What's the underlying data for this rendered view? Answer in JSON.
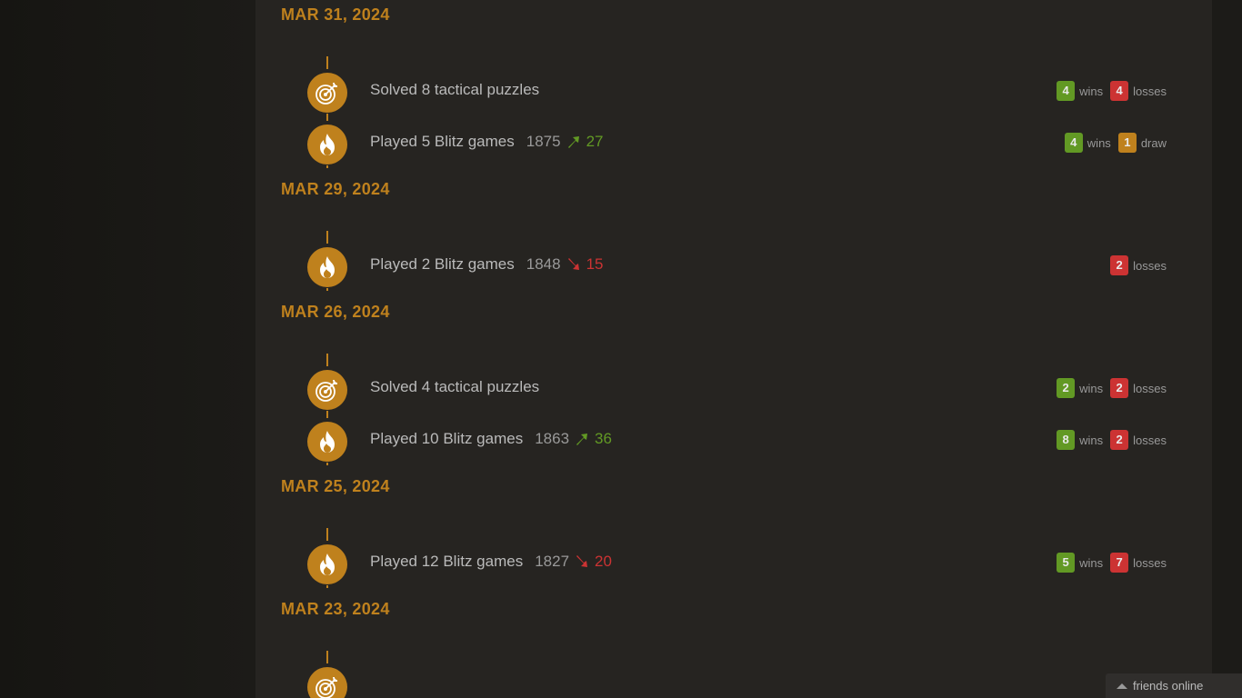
{
  "activity": [
    {
      "date": "MAR 31, 2024",
      "entries": [
        {
          "icon": "target-icon",
          "text": "Solved 8 tactical puzzles",
          "results": [
            {
              "n": "4",
              "label": "wins",
              "kind": "win"
            },
            {
              "n": "4",
              "label": "losses",
              "kind": "loss"
            }
          ]
        },
        {
          "icon": "flame-icon",
          "text": "Played 5 Blitz games",
          "rating": "1875",
          "delta": "27",
          "dir": "up",
          "results": [
            {
              "n": "4",
              "label": "wins",
              "kind": "win"
            },
            {
              "n": "1",
              "label": "draw",
              "kind": "draw"
            }
          ]
        }
      ]
    },
    {
      "date": "MAR 29, 2024",
      "entries": [
        {
          "icon": "flame-icon",
          "text": "Played 2 Blitz games",
          "rating": "1848",
          "delta": "15",
          "dir": "down",
          "results": [
            {
              "n": "2",
              "label": "losses",
              "kind": "loss"
            }
          ]
        }
      ]
    },
    {
      "date": "MAR 26, 2024",
      "entries": [
        {
          "icon": "target-icon",
          "text": "Solved 4 tactical puzzles",
          "results": [
            {
              "n": "2",
              "label": "wins",
              "kind": "win"
            },
            {
              "n": "2",
              "label": "losses",
              "kind": "loss"
            }
          ]
        },
        {
          "icon": "flame-icon",
          "text": "Played 10 Blitz games",
          "rating": "1863",
          "delta": "36",
          "dir": "up",
          "results": [
            {
              "n": "8",
              "label": "wins",
              "kind": "win"
            },
            {
              "n": "2",
              "label": "losses",
              "kind": "loss"
            }
          ]
        }
      ]
    },
    {
      "date": "MAR 25, 2024",
      "entries": [
        {
          "icon": "flame-icon",
          "text": "Played 12 Blitz games",
          "rating": "1827",
          "delta": "20",
          "dir": "down",
          "results": [
            {
              "n": "5",
              "label": "wins",
              "kind": "win"
            },
            {
              "n": "7",
              "label": "losses",
              "kind": "loss"
            }
          ]
        }
      ]
    },
    {
      "date": "MAR 23, 2024",
      "entries": [
        {
          "icon": "target-icon",
          "text": "",
          "results": []
        }
      ]
    }
  ],
  "friends": {
    "label": "friends online"
  },
  "colors": {
    "accent": "#bf811d",
    "win": "#629924",
    "loss": "#cc3333",
    "panel": "#262421"
  }
}
